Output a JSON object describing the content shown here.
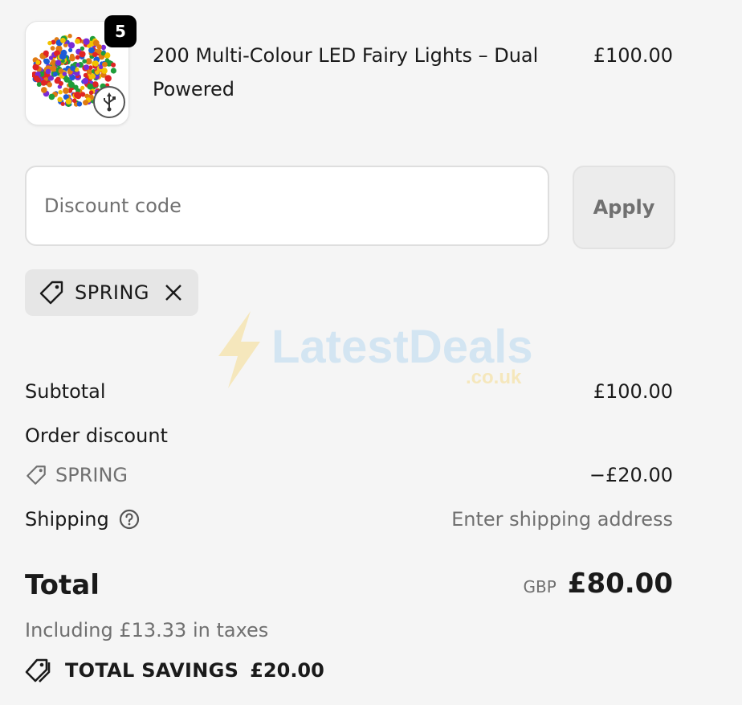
{
  "product": {
    "name": "200 Multi-Colour LED Fairy Lights – Dual Powered",
    "price": "£100.00",
    "quantity": "5",
    "image_icon": "fairy-lights-image",
    "badge_icon": "usb-icon"
  },
  "discount": {
    "placeholder": "Discount code",
    "apply_label": "Apply",
    "applied_code": "SPRING"
  },
  "watermark": {
    "name": "LatestDeals",
    "domain": ".co.uk"
  },
  "summary": {
    "subtotal_label": "Subtotal",
    "subtotal_value": "£100.00",
    "order_discount_label": "Order discount",
    "discount_code": "SPRING",
    "discount_value": "−£20.00",
    "shipping_label": "Shipping",
    "shipping_value": "Enter shipping address",
    "total_label": "Total",
    "currency": "GBP",
    "total_value": "£80.00",
    "taxes_note": "Including £13.33 in taxes",
    "savings_label": "TOTAL SAVINGS",
    "savings_value": "£20.00"
  },
  "colors": {
    "background": "#f5f5f5",
    "text": "#1a1a1a",
    "muted": "#707070",
    "watermark_blue": "#b9d8f0",
    "watermark_yellow": "#f6dc8e"
  }
}
